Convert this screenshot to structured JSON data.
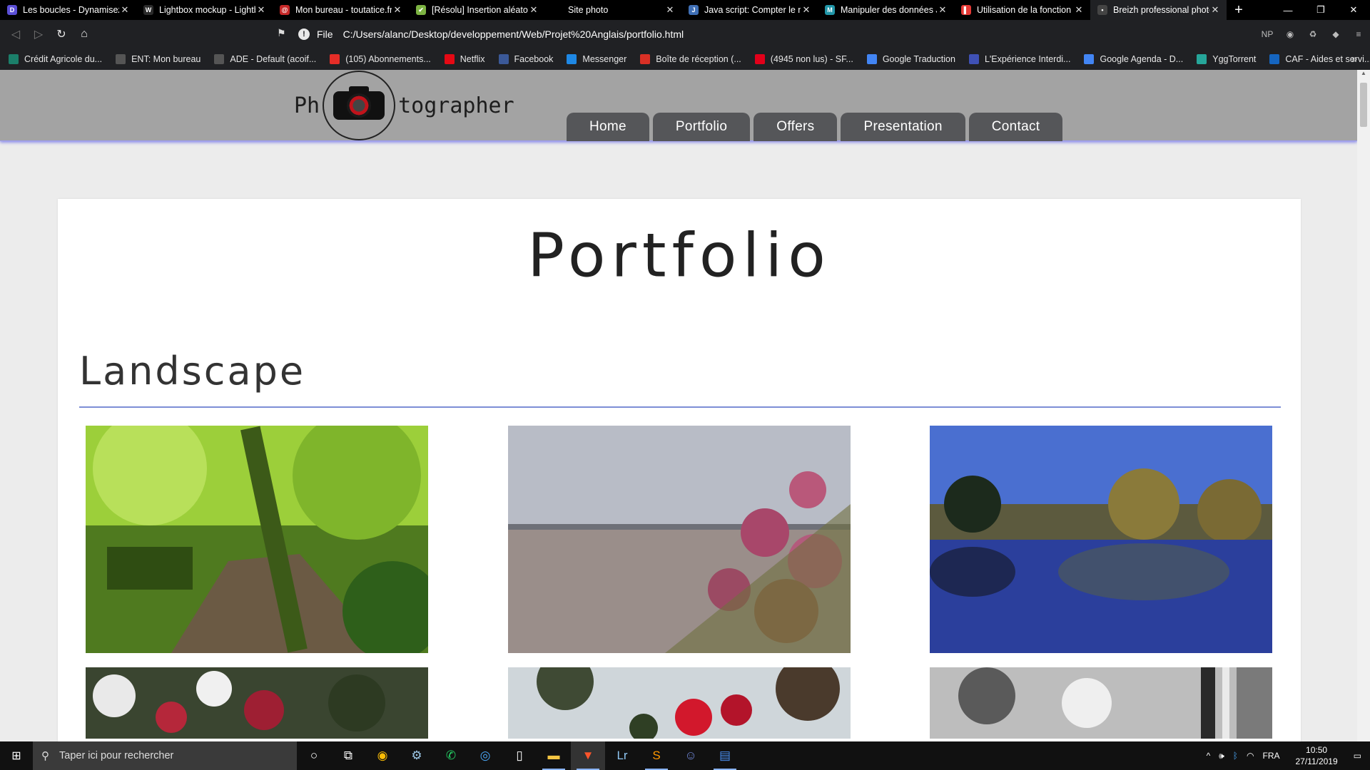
{
  "browser": {
    "tabs": [
      {
        "title": "Les boucles - Dynamisez",
        "icon": "D",
        "color": "#5b4fd6"
      },
      {
        "title": "Lightbox mockup - Lightb",
        "icon": "W",
        "color": "#2b2b2b"
      },
      {
        "title": "Mon bureau - toutatice.fr",
        "icon": "@",
        "color": "#c62828"
      },
      {
        "title": "[Résolu] Insertion aléatoi",
        "icon": "✔",
        "color": "#7cb342"
      },
      {
        "title": "Site photo",
        "icon": "",
        "color": "#000000"
      },
      {
        "title": "Java script: Compter le n",
        "icon": "J",
        "color": "#3f6fb5"
      },
      {
        "title": "Manipuler des données J",
        "icon": "M",
        "color": "#2196a8"
      },
      {
        "title": "Utilisation de la fonction",
        "icon": "▌",
        "color": "#e53935"
      },
      {
        "title": "Breizh professional photo",
        "icon": "•",
        "color": "#444444"
      }
    ],
    "active_tab_index": 8,
    "new_tab_label": "+",
    "window_controls": {
      "minimize": "—",
      "restore": "❐",
      "close": "✕"
    },
    "address": {
      "scheme": "File",
      "url": "C:/Users/alanc/Desktop/developpement/Web/Projet%20Anglais/portfolio.html"
    },
    "extensions": [
      "NP",
      "◉",
      "♻",
      "◆",
      "≡"
    ],
    "bookmarks": [
      {
        "label": "Crédit Agricole du...",
        "color": "#1b7f6a"
      },
      {
        "label": "ENT: Mon bureau",
        "color": "#555555"
      },
      {
        "label": "ADE - Default (acoif...",
        "color": "#555555"
      },
      {
        "label": "(105) Abonnements...",
        "color": "#e52d27"
      },
      {
        "label": "Netflix",
        "color": "#e50914"
      },
      {
        "label": "Facebook",
        "color": "#3b5998"
      },
      {
        "label": "Messenger",
        "color": "#1e88e5"
      },
      {
        "label": "Boîte de réception (...",
        "color": "#d93025"
      },
      {
        "label": "(4945 non lus) - SF...",
        "color": "#e2001a"
      },
      {
        "label": "Google Traduction",
        "color": "#4285f4"
      },
      {
        "label": "L'Expérience Interdi...",
        "color": "#3f51b5"
      },
      {
        "label": "Google Agenda - D...",
        "color": "#4285f4"
      },
      {
        "label": "YggTorrent",
        "color": "#26a69a"
      },
      {
        "label": "CAF - Aides et servi...",
        "color": "#1565c0"
      }
    ]
  },
  "site": {
    "logo_left": "Ph",
    "logo_right": "tographer",
    "nav": [
      "Home",
      "Portfolio",
      "Offers",
      "Presentation",
      "Contact"
    ],
    "page_title": "Portfolio",
    "section_title": "Landscape",
    "photos": [
      {
        "subject": "forest-path"
      },
      {
        "subject": "beach-flowers"
      },
      {
        "subject": "lake-reflection"
      },
      {
        "subject": "red-flowers-tree"
      },
      {
        "subject": "red-flowers-sky"
      },
      {
        "subject": "window-bw"
      }
    ]
  },
  "taskbar": {
    "search_placeholder": "Taper ici pour rechercher",
    "language": "FRA",
    "time": "10:50",
    "date": "27/11/2019"
  }
}
